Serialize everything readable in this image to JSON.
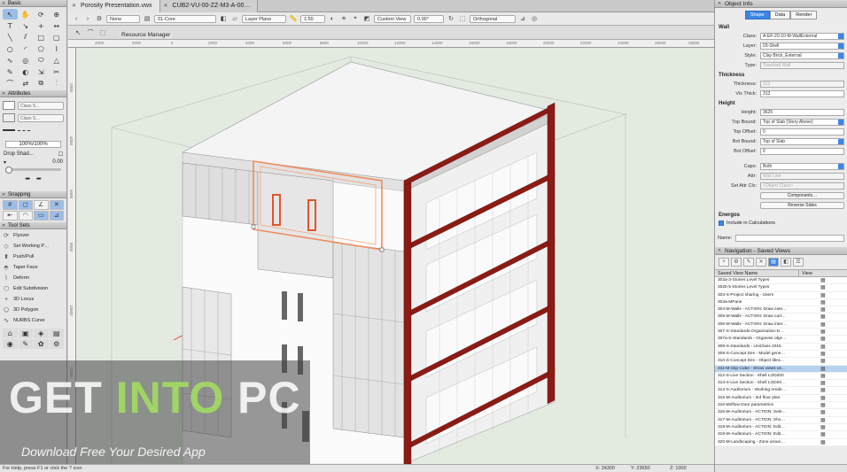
{
  "palettes": {
    "basic": "Basic",
    "attributes": "Attributes",
    "class_style_1": "Class S…",
    "class_style_2": "Class S…",
    "opacity": "100%/100%",
    "drop_shadow": "Drop Shad…",
    "drop_shadow_value": "0.00",
    "snapping": "Snapping",
    "tool_sets": "Tool Sets",
    "tools": [
      "Flyover",
      "Set Working P…",
      "Push/Pull",
      "Taper Face",
      "Deform",
      "Edit Subdivision",
      "3D Locus",
      "3D Polygon",
      "NURBS Curve"
    ]
  },
  "tabs": [
    {
      "label": "Porosity Presentation.vwx"
    },
    {
      "label": "CUB2-VU-00-ZZ-M3-A-00…"
    }
  ],
  "viewbar": {
    "none": "None",
    "layer": "01-Core",
    "plane": "Layer Plane",
    "scale": "1:50",
    "view": "Custom View",
    "angle": "0.00°",
    "projection": "Orthogonal"
  },
  "resource_manager": "Resource Manager",
  "ruler": {
    "h": [
      "4000",
      "2000",
      "0",
      "2000",
      "4000",
      "6000",
      "8000",
      "10000",
      "12000",
      "14000",
      "16000",
      "18000",
      "20000",
      "22000",
      "24000",
      "26000",
      "28000"
    ],
    "v": [
      "2000",
      "4000",
      "6000",
      "8000",
      "10000",
      "12000"
    ]
  },
  "watermark": {
    "part1": "GET ",
    "part2": "INTO",
    "part3": " PC",
    "tagline": "Download Free Your Desired App"
  },
  "status": {
    "help": "For Help, press F1 or click the ? icon",
    "x1": "X: 24300",
    "y1": "Y: 23650",
    "z1": "Z: 1000",
    "x2": "X: 24300",
    "y2": "Y: 23650",
    "z2": "Z: 1000"
  },
  "object_info": {
    "title": "Object Info",
    "tabs": [
      "Shape",
      "Data",
      "Render"
    ],
    "type_name": "Wall",
    "rows1": [
      {
        "label": "Class:",
        "value": "A-EF-20-10-M-WallExternal",
        "kind": "sel"
      },
      {
        "label": "Layer:",
        "value": "03-Shell",
        "kind": "sel"
      },
      {
        "label": "Style:",
        "value": "Clay Brick_External",
        "kind": "sel"
      },
      {
        "label": "Type:",
        "value": "Standard Wall",
        "kind": "dis"
      }
    ],
    "thickness_head": "Thickness",
    "rows2": [
      {
        "label": "Thickness:",
        "value": "313",
        "kind": "dis"
      },
      {
        "label": "Vis Thick:",
        "value": "313",
        "kind": "plain"
      }
    ],
    "height_head": "Height",
    "rows3": [
      {
        "label": "Height:",
        "value": "3625",
        "kind": "plain"
      },
      {
        "label": "Top Bound:",
        "value": "Top of Slab (Story Above)",
        "kind": "sel"
      },
      {
        "label": "Top Offset:",
        "value": "0",
        "kind": "plain"
      },
      {
        "label": "Bot Bound:",
        "value": "Top of Slab",
        "kind": "sel"
      },
      {
        "label": "Bot Offset:",
        "value": "0",
        "kind": "plain"
      }
    ],
    "rows4": [
      {
        "label": "Caps:",
        "value": "Both",
        "kind": "sel"
      },
      {
        "label": "Attr:",
        "value": "Wall Line",
        "kind": "dis"
      },
      {
        "label": "Set Attr Cls:",
        "value": "<Object Class>",
        "kind": "dis"
      }
    ],
    "components_btn": "Components…",
    "reverse_btn": "Reverse Sides",
    "energos_head": "Energos",
    "include_calc": "Include in Calculations",
    "name_label": "Name:"
  },
  "navigation": {
    "title": "Navigation - Saved Views",
    "col_name": "Saved View Name",
    "col_view": "View",
    "views": [
      "302a-3-Stories Level Types",
      "302b-5-Stories Level Types",
      "303-S-Project sharing - Users",
      "303a-MPane",
      "304-M-Walls - ACTION: Draw exte…",
      "305-M-Walls - ACTION: Draw curt…",
      "306-M-Walls - ACTION: Draw inter…",
      "307-S-Standards-Organisation-D…",
      "307a-S-Standards - Organise obje…",
      "308-S-Standards - UniClass 2015",
      "309-S-Concept Dev - Model gene…",
      "310-S-Concept Dev - Object libra…",
      "311-M-Clip Cube - Show views on…",
      "312-S-Live Section - Shell LOD200",
      "313-S-Live Section - Shell LOD20…",
      "314-S-Auditorium - Working rende…",
      "315-M-Auditorium - 3rd floor plan",
      "316-Mirflow Door parametrics",
      "316-M-Auditorium - ACTION: Sele…",
      "317-M-Auditorium - ACTION: Sho…",
      "318-M-Auditorium - ACTION: Edit…",
      "319-M-Auditorium - ACTION: Edit…",
      "320-M-Landscaping - Zone aroun…"
    ],
    "selected_index": 12
  }
}
